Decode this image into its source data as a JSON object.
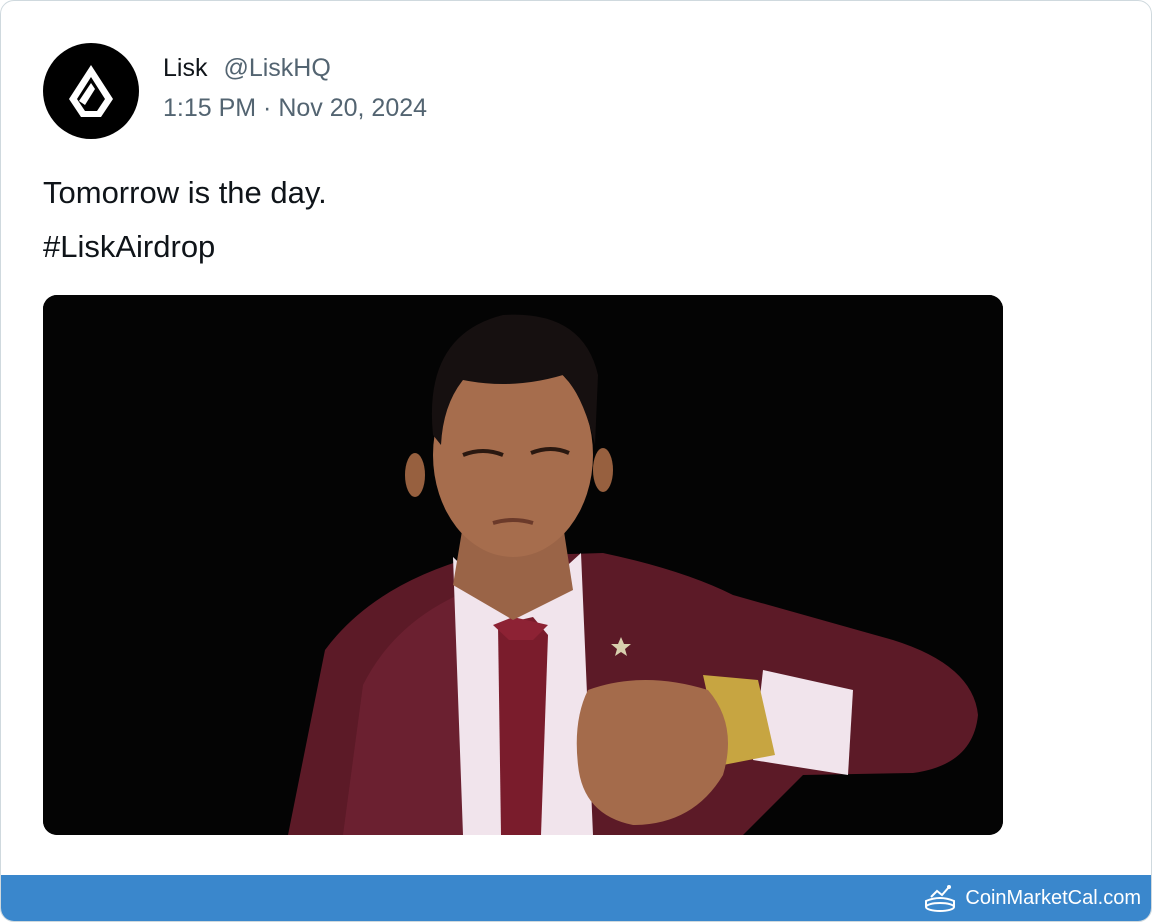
{
  "tweet": {
    "author_name": "Lisk",
    "author_handle": "@LiskHQ",
    "timestamp": "1:15 PM · Nov 20, 2024",
    "text_lines": [
      "Tomorrow is the day.",
      "#LiskAirdrop"
    ],
    "avatar_icon": "lisk-logo-icon",
    "media_icon": "man-checking-watch-image"
  },
  "footer": {
    "brand": "CoinMarketCal.com",
    "brand_icon": "coinmarketcal-logo-icon",
    "color": "#3a87cc"
  }
}
